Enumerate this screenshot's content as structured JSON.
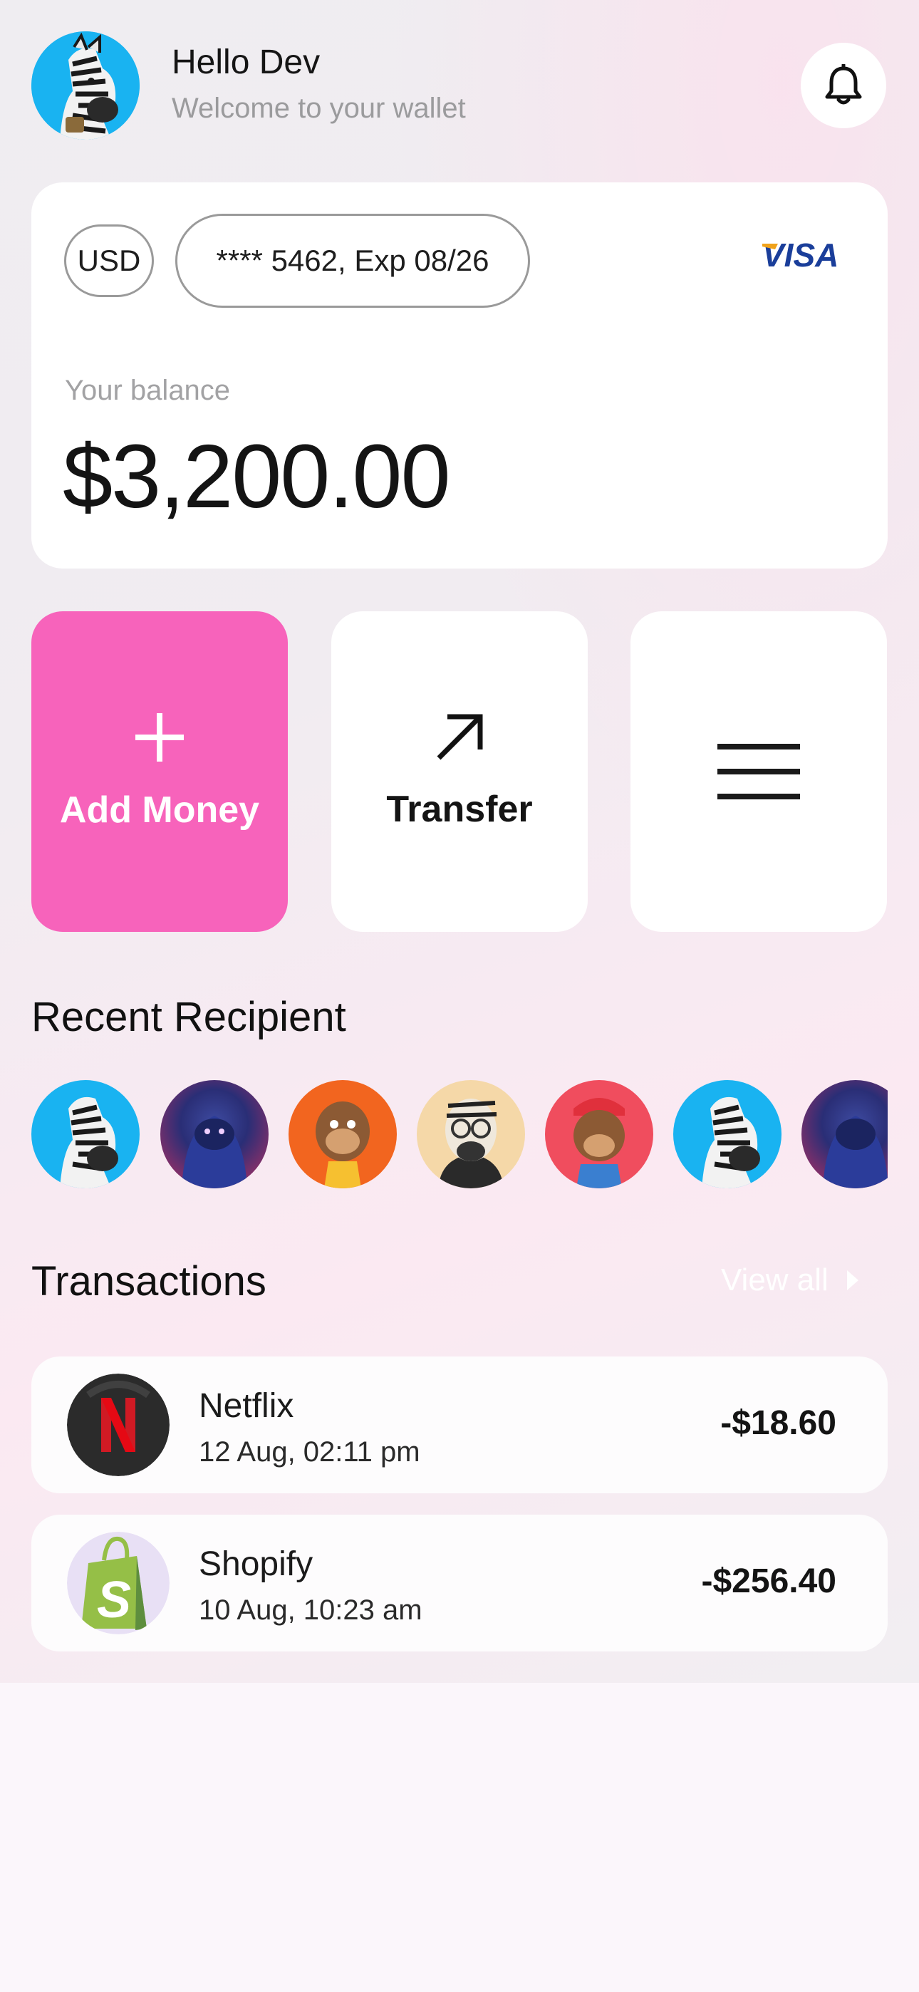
{
  "header": {
    "greeting": "Hello Dev",
    "subtitle": "Welcome to your wallet",
    "avatar_icon": "zebra-avatar",
    "notification_icon": "bell-icon"
  },
  "card": {
    "currency": "USD",
    "card_number": "**** 5462, Exp 08/26",
    "brand": "VISA",
    "balance_label": "Your balance",
    "balance": "$3,200.00"
  },
  "actions": {
    "add_money": "Add Money",
    "transfer": "Transfer",
    "add_icon": "plus-icon",
    "transfer_icon": "arrow-up-right-icon",
    "menu_icon": "hamburger-menu-icon"
  },
  "recent": {
    "title": "Recent Recipient",
    "recipients": [
      "zebra",
      "gorilla",
      "monkey-orange",
      "zebra-glasses",
      "monkey-red",
      "zebra",
      "gorilla"
    ]
  },
  "transactions": {
    "title": "Transactions",
    "view_all": "View all",
    "items": [
      {
        "name": "Netflix",
        "date": "12 Aug, 02:11 pm",
        "amount": "-$18.60",
        "icon": "netflix-logo"
      },
      {
        "name": "Shopify",
        "date": "10 Aug, 10:23 am",
        "amount": "-$256.40",
        "icon": "shopify-logo"
      }
    ]
  },
  "colors": {
    "accent": "#f763bb",
    "visa_blue": "#1a3e9a",
    "visa_gold": "#f0a21a"
  }
}
